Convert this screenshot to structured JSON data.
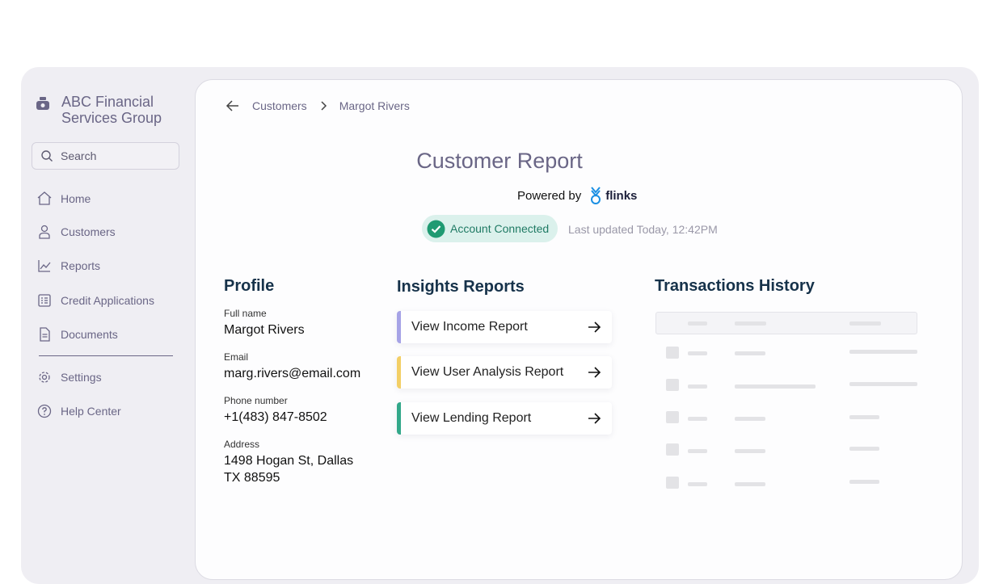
{
  "sidebar": {
    "brand": "ABC Financial Services Group",
    "search_placeholder": "Search",
    "items": [
      {
        "label": "Home",
        "icon": "home-icon"
      },
      {
        "label": "Customers",
        "icon": "user-icon"
      },
      {
        "label": "Reports",
        "icon": "chart-icon"
      },
      {
        "label": "Credit Applications",
        "icon": "form-icon"
      },
      {
        "label": "Documents",
        "icon": "document-icon"
      },
      {
        "label": "Settings",
        "icon": "gear-icon"
      },
      {
        "label": "Help Center",
        "icon": "help-icon"
      }
    ]
  },
  "breadcrumb": {
    "parent": "Customers",
    "current": "Margot Rivers"
  },
  "report": {
    "title": "Customer Report",
    "powered_by": "Powered by",
    "provider": "flinks",
    "status": "Account Connected",
    "last_updated": "Last updated Today, 12:42PM"
  },
  "profile": {
    "title": "Profile",
    "fields": [
      {
        "label": "Full name",
        "value": "Margot Rivers"
      },
      {
        "label": "Email",
        "value": "marg.rivers@email.com"
      },
      {
        "label": "Phone number",
        "value": "+1(483) 847-8502"
      },
      {
        "label": "Address",
        "value": "1498 Hogan St, Dallas",
        "value2": "TX 88595"
      }
    ]
  },
  "insights": {
    "title": "Insights Reports",
    "cards": [
      {
        "label": "View Income Report",
        "color": "#a6a3e6"
      },
      {
        "label": "View User Analysis Report",
        "color": "#f3cf66"
      },
      {
        "label": "View Lending Report",
        "color": "#33a88a"
      }
    ]
  },
  "transactions": {
    "title": "Transactions History"
  },
  "colors": {
    "accent": "#6a6686",
    "heading": "#16324a",
    "success": "#1f9a72"
  }
}
